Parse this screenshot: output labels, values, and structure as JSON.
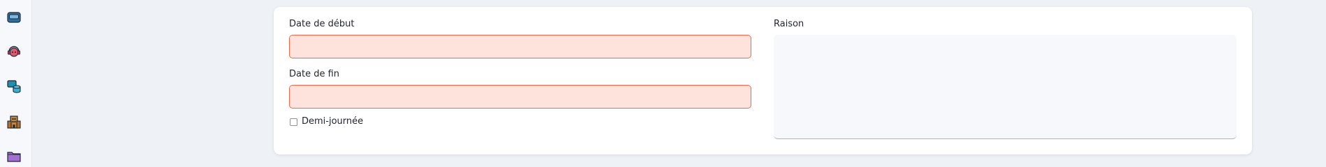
{
  "sidebar": {
    "items": [
      {
        "icon": "inbox-tray-icon"
      },
      {
        "icon": "helpdesk-headset-icon"
      },
      {
        "icon": "database-stack-icon"
      },
      {
        "icon": "office-building-icon"
      },
      {
        "icon": "folder-icon"
      }
    ]
  },
  "form": {
    "start_date": {
      "label": "Date de début",
      "value": ""
    },
    "end_date": {
      "label": "Date de fin",
      "value": ""
    },
    "half_day": {
      "label": "Demi-journée",
      "checked": false
    },
    "reason": {
      "label": "Raison",
      "value": ""
    }
  },
  "colors": {
    "invalid_field_bg": "#fde3db",
    "invalid_field_border": "#f06a48",
    "page_bg": "#eef1f6"
  }
}
